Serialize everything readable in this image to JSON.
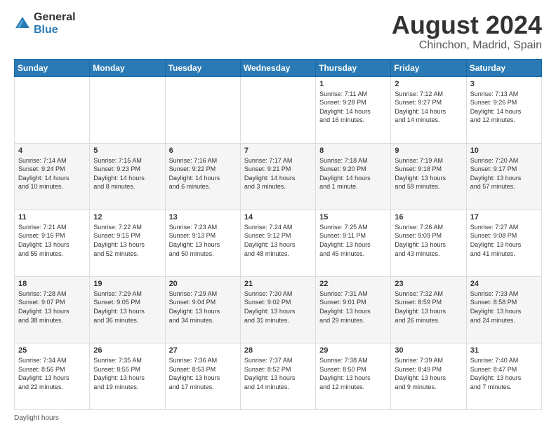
{
  "logo": {
    "general": "General",
    "blue": "Blue"
  },
  "title": "August 2024",
  "subtitle": "Chinchon, Madrid, Spain",
  "weekdays": [
    "Sunday",
    "Monday",
    "Tuesday",
    "Wednesday",
    "Thursday",
    "Friday",
    "Saturday"
  ],
  "footer_label": "Daylight hours",
  "weeks": [
    [
      {
        "day": "",
        "info": ""
      },
      {
        "day": "",
        "info": ""
      },
      {
        "day": "",
        "info": ""
      },
      {
        "day": "",
        "info": ""
      },
      {
        "day": "1",
        "info": "Sunrise: 7:11 AM\nSunset: 9:28 PM\nDaylight: 14 hours\nand 16 minutes."
      },
      {
        "day": "2",
        "info": "Sunrise: 7:12 AM\nSunset: 9:27 PM\nDaylight: 14 hours\nand 14 minutes."
      },
      {
        "day": "3",
        "info": "Sunrise: 7:13 AM\nSunset: 9:26 PM\nDaylight: 14 hours\nand 12 minutes."
      }
    ],
    [
      {
        "day": "4",
        "info": "Sunrise: 7:14 AM\nSunset: 9:24 PM\nDaylight: 14 hours\nand 10 minutes."
      },
      {
        "day": "5",
        "info": "Sunrise: 7:15 AM\nSunset: 9:23 PM\nDaylight: 14 hours\nand 8 minutes."
      },
      {
        "day": "6",
        "info": "Sunrise: 7:16 AM\nSunset: 9:22 PM\nDaylight: 14 hours\nand 6 minutes."
      },
      {
        "day": "7",
        "info": "Sunrise: 7:17 AM\nSunset: 9:21 PM\nDaylight: 14 hours\nand 3 minutes."
      },
      {
        "day": "8",
        "info": "Sunrise: 7:18 AM\nSunset: 9:20 PM\nDaylight: 14 hours\nand 1 minute."
      },
      {
        "day": "9",
        "info": "Sunrise: 7:19 AM\nSunset: 9:18 PM\nDaylight: 13 hours\nand 59 minutes."
      },
      {
        "day": "10",
        "info": "Sunrise: 7:20 AM\nSunset: 9:17 PM\nDaylight: 13 hours\nand 57 minutes."
      }
    ],
    [
      {
        "day": "11",
        "info": "Sunrise: 7:21 AM\nSunset: 9:16 PM\nDaylight: 13 hours\nand 55 minutes."
      },
      {
        "day": "12",
        "info": "Sunrise: 7:22 AM\nSunset: 9:15 PM\nDaylight: 13 hours\nand 52 minutes."
      },
      {
        "day": "13",
        "info": "Sunrise: 7:23 AM\nSunset: 9:13 PM\nDaylight: 13 hours\nand 50 minutes."
      },
      {
        "day": "14",
        "info": "Sunrise: 7:24 AM\nSunset: 9:12 PM\nDaylight: 13 hours\nand 48 minutes."
      },
      {
        "day": "15",
        "info": "Sunrise: 7:25 AM\nSunset: 9:11 PM\nDaylight: 13 hours\nand 45 minutes."
      },
      {
        "day": "16",
        "info": "Sunrise: 7:26 AM\nSunset: 9:09 PM\nDaylight: 13 hours\nand 43 minutes."
      },
      {
        "day": "17",
        "info": "Sunrise: 7:27 AM\nSunset: 9:08 PM\nDaylight: 13 hours\nand 41 minutes."
      }
    ],
    [
      {
        "day": "18",
        "info": "Sunrise: 7:28 AM\nSunset: 9:07 PM\nDaylight: 13 hours\nand 38 minutes."
      },
      {
        "day": "19",
        "info": "Sunrise: 7:29 AM\nSunset: 9:05 PM\nDaylight: 13 hours\nand 36 minutes."
      },
      {
        "day": "20",
        "info": "Sunrise: 7:29 AM\nSunset: 9:04 PM\nDaylight: 13 hours\nand 34 minutes."
      },
      {
        "day": "21",
        "info": "Sunrise: 7:30 AM\nSunset: 9:02 PM\nDaylight: 13 hours\nand 31 minutes."
      },
      {
        "day": "22",
        "info": "Sunrise: 7:31 AM\nSunset: 9:01 PM\nDaylight: 13 hours\nand 29 minutes."
      },
      {
        "day": "23",
        "info": "Sunrise: 7:32 AM\nSunset: 8:59 PM\nDaylight: 13 hours\nand 26 minutes."
      },
      {
        "day": "24",
        "info": "Sunrise: 7:33 AM\nSunset: 8:58 PM\nDaylight: 13 hours\nand 24 minutes."
      }
    ],
    [
      {
        "day": "25",
        "info": "Sunrise: 7:34 AM\nSunset: 8:56 PM\nDaylight: 13 hours\nand 22 minutes."
      },
      {
        "day": "26",
        "info": "Sunrise: 7:35 AM\nSunset: 8:55 PM\nDaylight: 13 hours\nand 19 minutes."
      },
      {
        "day": "27",
        "info": "Sunrise: 7:36 AM\nSunset: 8:53 PM\nDaylight: 13 hours\nand 17 minutes."
      },
      {
        "day": "28",
        "info": "Sunrise: 7:37 AM\nSunset: 8:52 PM\nDaylight: 13 hours\nand 14 minutes."
      },
      {
        "day": "29",
        "info": "Sunrise: 7:38 AM\nSunset: 8:50 PM\nDaylight: 13 hours\nand 12 minutes."
      },
      {
        "day": "30",
        "info": "Sunrise: 7:39 AM\nSunset: 8:49 PM\nDaylight: 13 hours\nand 9 minutes."
      },
      {
        "day": "31",
        "info": "Sunrise: 7:40 AM\nSunset: 8:47 PM\nDaylight: 13 hours\nand 7 minutes."
      }
    ]
  ]
}
